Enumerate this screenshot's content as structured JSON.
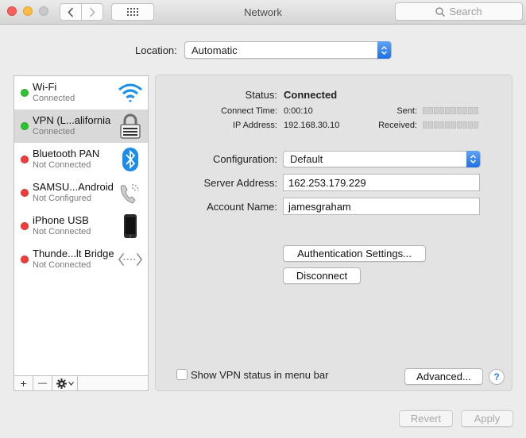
{
  "window": {
    "title": "Network"
  },
  "toolbar": {
    "search_placeholder": "Search"
  },
  "location": {
    "label": "Location:",
    "value": "Automatic"
  },
  "services": [
    {
      "name": "Wi-Fi",
      "status": "Connected",
      "status_color": "#2ec42f",
      "icon": "wifi-icon"
    },
    {
      "name": "VPN (L...alifornia",
      "status": "Connected",
      "status_color": "#2ec42f",
      "icon": "vpn-lock-icon"
    },
    {
      "name": "Bluetooth PAN",
      "status": "Not Connected",
      "status_color": "#f03d3b",
      "icon": "bluetooth-icon"
    },
    {
      "name": "SAMSU...Android",
      "status": "Not Configured",
      "status_color": "#f03d3b",
      "icon": "phone-handset-icon"
    },
    {
      "name": "iPhone USB",
      "status": "Not Connected",
      "status_color": "#f03d3b",
      "icon": "iphone-icon"
    },
    {
      "name": "Thunde...lt Bridge",
      "status": "Not Connected",
      "status_color": "#f03d3b",
      "icon": "thunderbolt-bridge-icon"
    }
  ],
  "sidebar_controls": {
    "add": "+",
    "remove": "—"
  },
  "detail": {
    "status_label": "Status:",
    "status_value": "Connected",
    "connect_time_label": "Connect Time:",
    "connect_time_value": "0:00:10",
    "ip_label": "IP Address:",
    "ip_value": "192.168.30.10",
    "sent_label": "Sent:",
    "received_label": "Received:",
    "configuration_label": "Configuration:",
    "configuration_value": "Default",
    "server_label": "Server Address:",
    "server_value": "162.253.179.229",
    "account_label": "Account Name:",
    "account_value": "jamesgraham",
    "auth_button": "Authentication Settings...",
    "disconnect_button": "Disconnect",
    "show_vpn_label": "Show VPN status in menu bar",
    "show_vpn_checked": false,
    "advanced_button": "Advanced...",
    "help": "?"
  },
  "footer": {
    "revert": "Revert",
    "apply": "Apply"
  },
  "colors": {
    "accent": "#1f6fe5",
    "connected": "#2ec42f",
    "disconnected": "#f03d3b"
  }
}
